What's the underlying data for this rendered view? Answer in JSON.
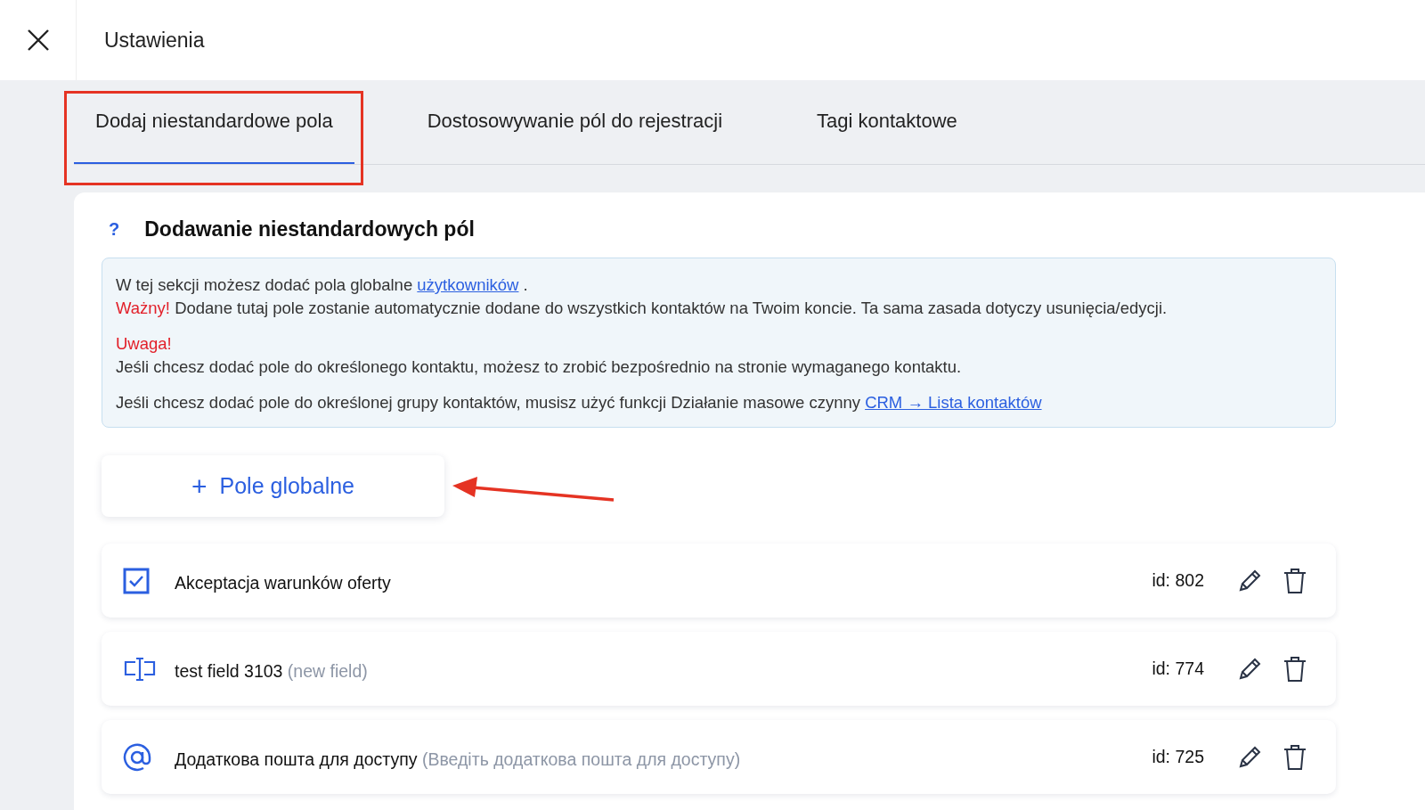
{
  "header": {
    "title": "Ustawienia"
  },
  "tabs": [
    {
      "label": "Dodaj niestandardowe pola",
      "selected": true,
      "highlighted": true
    },
    {
      "label": "Dostosowywanie pól do rejestracji",
      "selected": false,
      "highlighted": false
    },
    {
      "label": "Tagi kontaktowe",
      "selected": false,
      "highlighted": false
    }
  ],
  "section": {
    "help": "?",
    "title": "Dodawanie niestandardowych pól"
  },
  "info": {
    "intro": {
      "text": "W tej sekcji możesz dodać pola globalne ",
      "link": "użytkowników",
      "after": " ."
    },
    "important": {
      "label": "Ważny!",
      "text": " Dodane tutaj pole zostanie automatycznie dodane do wszystkich kontaktów na Twoim koncie. Ta sama zasada dotyczy usunięcia/edycji."
    },
    "warning": "Uwaga!",
    "contact": "Jeśli chcesz dodać pole do określonego kontaktu, możesz to zrobić bezpośrednio na stronie wymaganego kontaktu.",
    "group": {
      "text": "Jeśli chcesz dodać pole do określonej grupy kontaktów, musisz użyć funkcji Działanie masowe czynny ",
      "link": "CRM → Lista kontaktów"
    }
  },
  "add_button": {
    "icon": "+",
    "label": "Pole globalne",
    "pointed": true
  },
  "fields": [
    {
      "kind": "checkbox",
      "name": "Akceptacja warunków oferty",
      "id": "id: 802"
    },
    {
      "kind": "text",
      "name": "test field 3103",
      "hint": "(new field)",
      "id": "id: 774"
    },
    {
      "kind": "email",
      "name": "Додаткова пошта для доступу",
      "hint": "(Введіть додаткова пошта для доступу)",
      "id": "id: 725"
    }
  ]
}
